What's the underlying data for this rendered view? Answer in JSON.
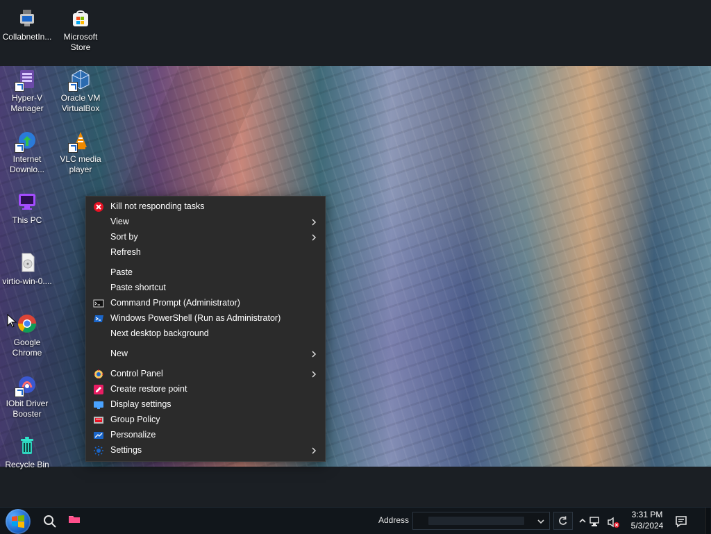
{
  "desktop": {
    "icons": [
      {
        "label": "CollabnetIn...",
        "icon": "collabnet-installer-icon"
      },
      {
        "label": "Microsoft\nStore",
        "icon": "microsoft-store-icon"
      },
      {
        "label": "Hyper-V\nManager",
        "icon": "hyper-v-manager-icon"
      },
      {
        "label": "Oracle VM\nVirtualBox",
        "icon": "virtualbox-icon"
      },
      {
        "label": "Internet\nDownlo...",
        "icon": "internet-download-manager-icon"
      },
      {
        "label": "VLC media\nplayer",
        "icon": "vlc-icon"
      },
      {
        "label": "This PC",
        "icon": "this-pc-icon"
      },
      {
        "label": "virtio-win-0....",
        "icon": "virtio-disc-icon"
      },
      {
        "label": "Google\nChrome",
        "icon": "chrome-icon"
      },
      {
        "label": "IObit Driver\nBooster",
        "icon": "iobit-driver-booster-icon"
      },
      {
        "label": "Recycle Bin",
        "icon": "recycle-bin-icon"
      }
    ]
  },
  "context_menu": {
    "items": [
      {
        "label": "Kill not responding tasks",
        "icon": "kill-tasks-icon",
        "submenu": false
      },
      {
        "label": "View",
        "icon": "",
        "submenu": true
      },
      {
        "label": "Sort by",
        "icon": "",
        "submenu": true
      },
      {
        "label": "Refresh",
        "icon": "",
        "submenu": false
      },
      {
        "label": "Paste",
        "icon": "",
        "submenu": false
      },
      {
        "label": "Paste shortcut",
        "icon": "",
        "submenu": false
      },
      {
        "label": "Command Prompt (Administrator)",
        "icon": "cmd-icon",
        "submenu": false
      },
      {
        "label": "Windows PowerShell (Run as Administrator)",
        "icon": "powershell-icon",
        "submenu": false
      },
      {
        "label": "Next desktop background",
        "icon": "",
        "submenu": false
      },
      {
        "label": "New",
        "icon": "",
        "submenu": true
      },
      {
        "label": "Control Panel",
        "icon": "control-panel-icon",
        "submenu": true
      },
      {
        "label": "Create restore point",
        "icon": "restore-point-icon",
        "submenu": false
      },
      {
        "label": "Display settings",
        "icon": "display-settings-icon",
        "submenu": false
      },
      {
        "label": "Group Policy",
        "icon": "group-policy-icon",
        "submenu": false
      },
      {
        "label": "Personalize",
        "icon": "personalize-icon",
        "submenu": false
      },
      {
        "label": "Settings",
        "icon": "gear-icon",
        "submenu": true
      }
    ]
  },
  "taskbar": {
    "address_label": "Address",
    "clock_time": "3:31 PM",
    "clock_date": "5/3/2024"
  }
}
